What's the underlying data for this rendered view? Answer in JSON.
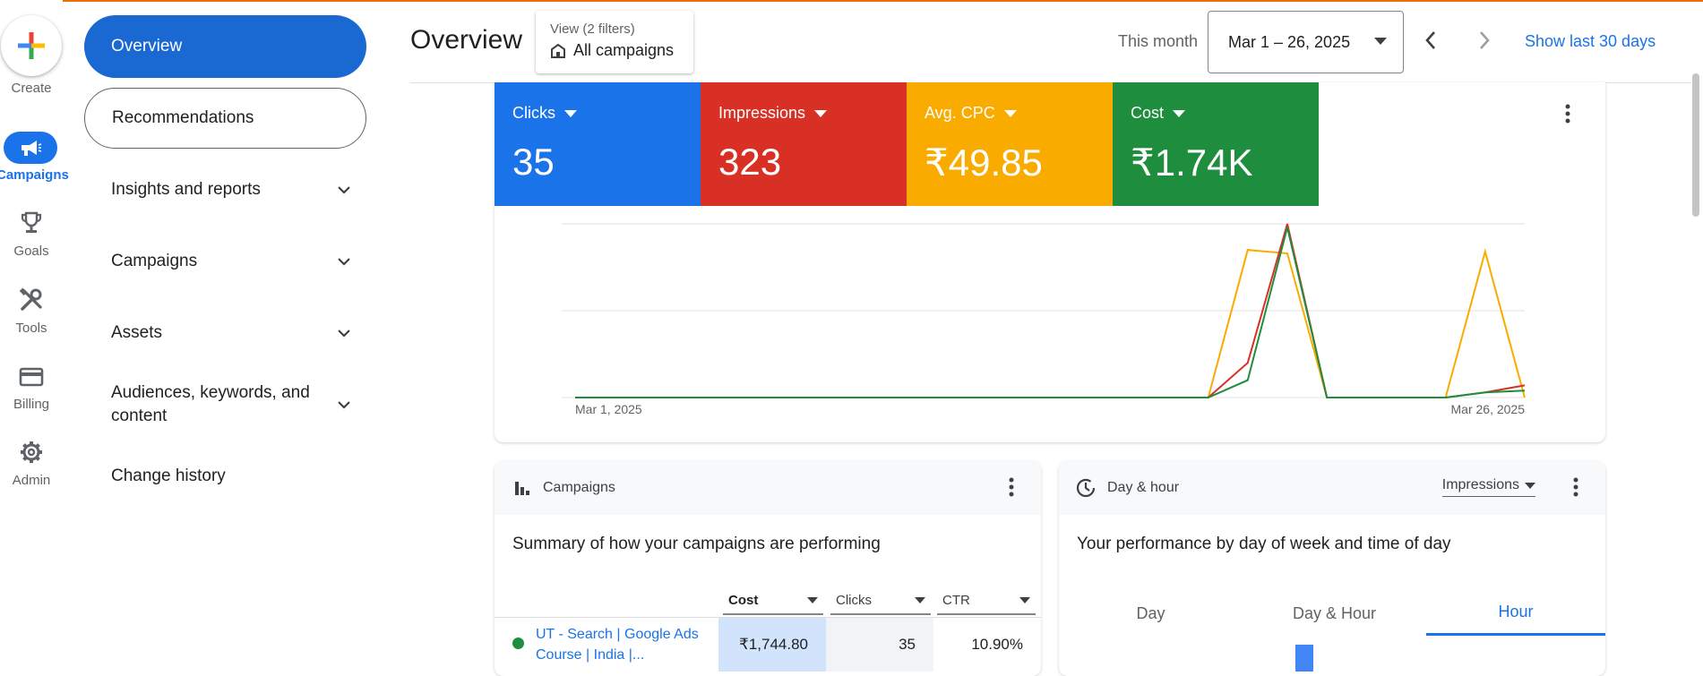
{
  "rail": {
    "create_label": "Create",
    "items": [
      {
        "label": "Campaigns",
        "icon": "megaphone-icon",
        "active": true
      },
      {
        "label": "Goals",
        "icon": "trophy-icon",
        "active": false
      },
      {
        "label": "Tools",
        "icon": "tools-icon",
        "active": false
      },
      {
        "label": "Billing",
        "icon": "card-icon",
        "active": false
      },
      {
        "label": "Admin",
        "icon": "gear-icon",
        "active": false
      }
    ]
  },
  "subnav": {
    "overview": "Overview",
    "recommendations": "Recommendations",
    "insights": "Insights and reports",
    "campaigns": "Campaigns",
    "assets": "Assets",
    "audiences": "Audiences, keywords, and content",
    "change_history": "Change history"
  },
  "header": {
    "title": "Overview",
    "view_filters": "View (2 filters)",
    "view_value": "All campaigns",
    "this_month": "This month",
    "date_range": "Mar 1 – 26, 2025",
    "show_last": "Show last 30 days"
  },
  "metrics": [
    {
      "label": "Clicks",
      "value": "35",
      "color": "#1a73e8"
    },
    {
      "label": "Impressions",
      "value": "323",
      "color": "#d93025"
    },
    {
      "label": "Avg. CPC",
      "value": "₹49.85",
      "color": "#f9ab00"
    },
    {
      "label": "Cost",
      "value": "₹1.74K",
      "color": "#1e8e3e"
    }
  ],
  "chart_data": {
    "type": "line",
    "x_start_label": "Mar 1, 2025",
    "x_end_label": "Mar 26, 2025",
    "x_days": [
      1,
      2,
      3,
      4,
      5,
      6,
      7,
      8,
      9,
      10,
      11,
      12,
      13,
      14,
      15,
      16,
      17,
      18,
      19,
      20,
      21,
      22,
      23,
      24,
      25,
      26
    ],
    "grid": true,
    "series": [
      {
        "color": "#f9ab00",
        "values": [
          0,
          0,
          0,
          0,
          0,
          0,
          0,
          0,
          0,
          0,
          0,
          0,
          0,
          0,
          0,
          0,
          0,
          0.85,
          0.83,
          0,
          0,
          0,
          0,
          0.84,
          0
        ]
      },
      {
        "color": "#d93025",
        "values": [
          0,
          0,
          0,
          0,
          0,
          0,
          0,
          0,
          0,
          0,
          0,
          0,
          0,
          0,
          0,
          0,
          0,
          0.2,
          1.0,
          0,
          0,
          0,
          0,
          0.03,
          0.07
        ]
      },
      {
        "color": "#1e8e3e",
        "values": [
          0,
          0,
          0,
          0,
          0,
          0,
          0,
          0,
          0,
          0,
          0,
          0,
          0,
          0,
          0,
          0,
          0,
          0.1,
          0.98,
          0,
          0,
          0,
          0,
          0.03,
          0.04
        ]
      }
    ]
  },
  "campaigns_card": {
    "title": "Campaigns",
    "subtitle": "Summary of how your campaigns are performing",
    "columns": [
      "Cost",
      "Clicks",
      "CTR"
    ],
    "rows": [
      {
        "name": "UT - Search | Google Ads Course | India |...",
        "cost": "₹1,744.80",
        "clicks": "35",
        "ctr": "10.90%"
      }
    ]
  },
  "dayhour_card": {
    "title": "Day & hour",
    "metric": "Impressions",
    "subtitle": "Your performance by day of week and time of day",
    "tabs": [
      "Day",
      "Day & Hour",
      "Hour"
    ],
    "active_tab": "Hour"
  }
}
